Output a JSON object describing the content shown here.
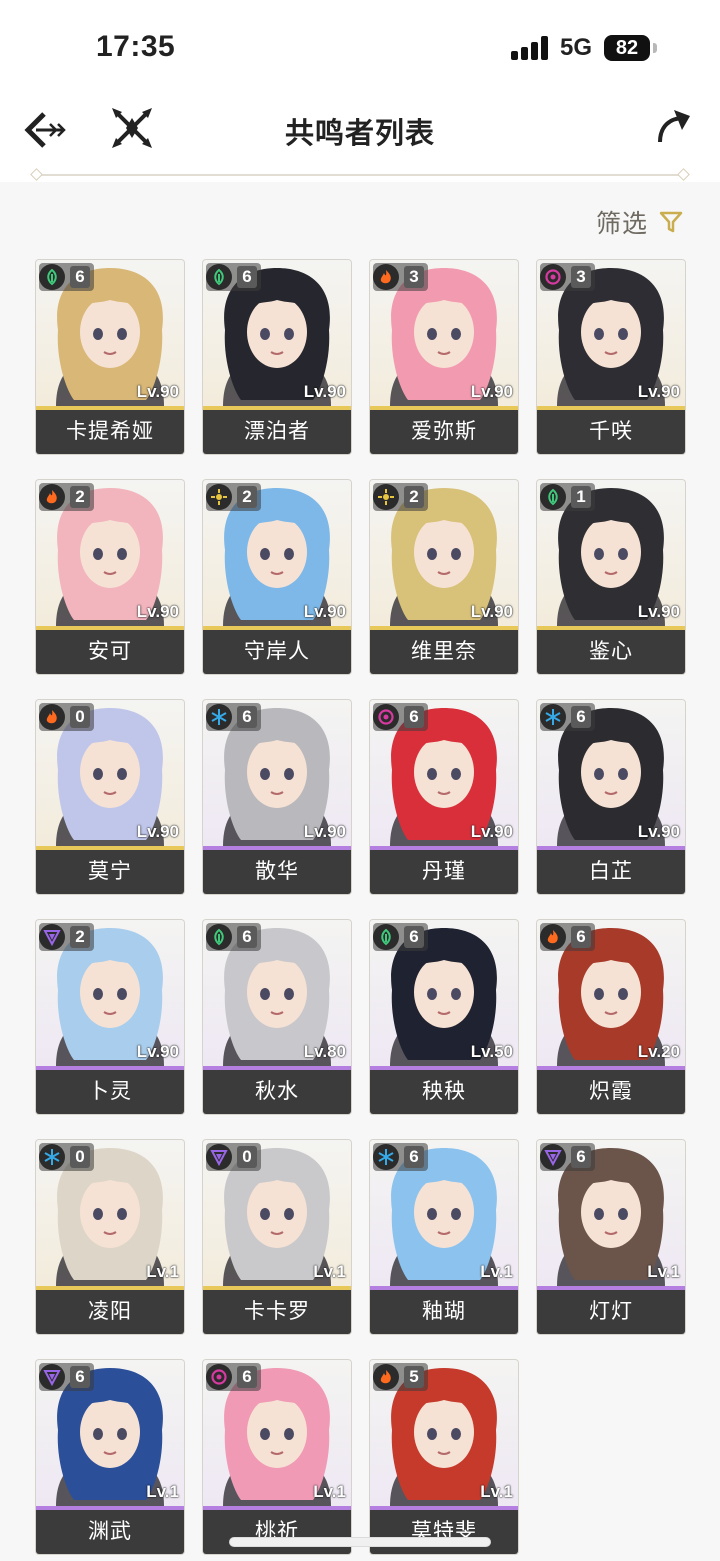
{
  "status_bar": {
    "time": "17:35",
    "network": "5G",
    "battery": "82"
  },
  "header": {
    "title": "共鸣者列表"
  },
  "filter": {
    "label": "筛选"
  },
  "colors": {
    "accent": "#c9ad4f",
    "name_bar": "#3b3b3b",
    "rarity_5": "#e9c85a",
    "rarity_4": "#b47fe0",
    "element_aero": "#3fc97a",
    "element_fusion": "#ff6a1f",
    "element_havoc": "#d63aa0",
    "element_spectro": "#e8c640",
    "element_glacio": "#36a9e8",
    "element_electro": "#9a66e8"
  },
  "characters": [
    {
      "name": "卡提希娅",
      "level": "Lv.90",
      "sequence": "6",
      "element": "aero",
      "rarity": 5,
      "hair": "#d9b777"
    },
    {
      "name": "漂泊者",
      "level": "Lv.90",
      "sequence": "6",
      "element": "aero",
      "rarity": 5,
      "hair": "#26272e"
    },
    {
      "name": "爱弥斯",
      "level": "Lv.90",
      "sequence": "3",
      "element": "fusion",
      "rarity": 5,
      "hair": "#f29bb0"
    },
    {
      "name": "千咲",
      "level": "Lv.90",
      "sequence": "3",
      "element": "havoc",
      "rarity": 5,
      "hair": "#2d2d33"
    },
    {
      "name": "安可",
      "level": "Lv.90",
      "sequence": "2",
      "element": "fusion",
      "rarity": 5,
      "hair": "#f2b4bd"
    },
    {
      "name": "守岸人",
      "level": "Lv.90",
      "sequence": "2",
      "element": "spectro",
      "rarity": 5,
      "hair": "#7db8e8"
    },
    {
      "name": "维里奈",
      "level": "Lv.90",
      "sequence": "2",
      "element": "spectro",
      "rarity": 5,
      "hair": "#d8c27a"
    },
    {
      "name": "鉴心",
      "level": "Lv.90",
      "sequence": "1",
      "element": "aero",
      "rarity": 5,
      "hair": "#2f2f33"
    },
    {
      "name": "莫宁",
      "level": "Lv.90",
      "sequence": "0",
      "element": "fusion",
      "rarity": 5,
      "hair": "#c0c6ea"
    },
    {
      "name": "散华",
      "level": "Lv.90",
      "sequence": "6",
      "element": "glacio",
      "rarity": 4,
      "hair": "#b9b9bd"
    },
    {
      "name": "丹瑾",
      "level": "Lv.90",
      "sequence": "6",
      "element": "havoc",
      "rarity": 4,
      "hair": "#d92f3a"
    },
    {
      "name": "白芷",
      "level": "Lv.90",
      "sequence": "6",
      "element": "glacio",
      "rarity": 4,
      "hair": "#2b2b30"
    },
    {
      "name": "卜灵",
      "level": "Lv.90",
      "sequence": "2",
      "element": "electro",
      "rarity": 4,
      "hair": "#a9cdec"
    },
    {
      "name": "秋水",
      "level": "Lv.80",
      "sequence": "6",
      "element": "aero",
      "rarity": 4,
      "hair": "#c8c8cc"
    },
    {
      "name": "秧秧",
      "level": "Lv.50",
      "sequence": "6",
      "element": "aero",
      "rarity": 4,
      "hair": "#1f2230"
    },
    {
      "name": "炽霞",
      "level": "Lv.20",
      "sequence": "6",
      "element": "fusion",
      "rarity": 4,
      "hair": "#a83a2a"
    },
    {
      "name": "凌阳",
      "level": "Lv.1",
      "sequence": "0",
      "element": "glacio",
      "rarity": 5,
      "hair": "#ddd6c8"
    },
    {
      "name": "卡卡罗",
      "level": "Lv.1",
      "sequence": "0",
      "element": "electro",
      "rarity": 5,
      "hair": "#c9c9cc"
    },
    {
      "name": "釉瑚",
      "level": "Lv.1",
      "sequence": "6",
      "element": "glacio",
      "rarity": 4,
      "hair": "#8cc3ee"
    },
    {
      "name": "灯灯",
      "level": "Lv.1",
      "sequence": "6",
      "element": "electro",
      "rarity": 4,
      "hair": "#6b544a"
    },
    {
      "name": "渊武",
      "level": "Lv.1",
      "sequence": "6",
      "element": "electro",
      "rarity": 4,
      "hair": "#2c4f9a"
    },
    {
      "name": "桃祈",
      "level": "Lv.1",
      "sequence": "6",
      "element": "havoc",
      "rarity": 4,
      "hair": "#f09ab6"
    },
    {
      "name": "莫特斐",
      "level": "Lv.1",
      "sequence": "5",
      "element": "fusion",
      "rarity": 4,
      "hair": "#c63a2c"
    }
  ]
}
